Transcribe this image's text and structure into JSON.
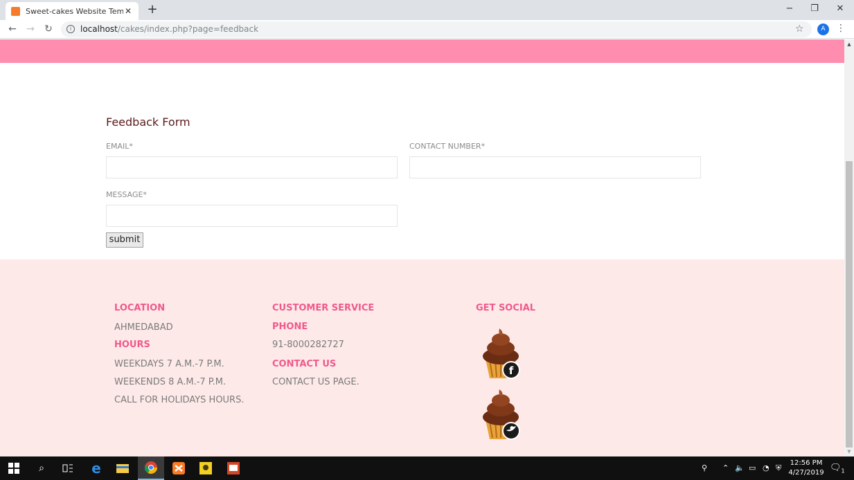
{
  "browser": {
    "tab_title": "Sweet-cakes Website Template |",
    "tab_close": "✕",
    "new_tab": "+",
    "url_host": "localhost",
    "url_path": "/cakes/index.php?page=feedback",
    "profile_initial": "A",
    "window_controls": {
      "minimize": "−",
      "restore": "❐",
      "close": "✕"
    }
  },
  "page": {
    "form": {
      "title": "Feedback Form",
      "email_label": "EMAIL*",
      "contact_label": "CONTACT NUMBER*",
      "message_label": "MESSAGE*",
      "email_value": "",
      "contact_value": "",
      "message_value": "",
      "submit_label": "submit"
    },
    "footer": {
      "location_heading": "LOCATION",
      "location_value": "AHMEDABAD",
      "hours_heading": "HOURS",
      "hours_weekdays": "WEEKDAYS 7 A.M.-7 P.M.",
      "hours_weekends": "WEEKENDS 8 A.M.-7 P.M.",
      "hours_holidays": "CALL FOR HOLIDAYS HOURS.",
      "customer_service_heading": "CUSTOMER SERVICE",
      "phone_heading": "PHONE",
      "phone_value": "91-8000282727",
      "contact_heading": "CONTACT US",
      "contact_value": "CONTACT US PAGE.",
      "social_heading": "GET SOCIAL",
      "social_icons": [
        "facebook-icon",
        "twitter-icon"
      ]
    }
  },
  "taskbar": {
    "time": "12:56 PM",
    "date": "4/27/2019",
    "notification_count": "1"
  },
  "colors": {
    "pink_bar": "#fe8db0",
    "footer_bg": "#fdeae8",
    "footer_heading": "#f0598d",
    "form_title": "#5b1a1a"
  }
}
